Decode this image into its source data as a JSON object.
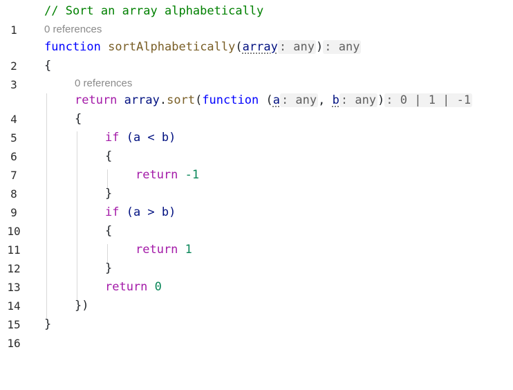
{
  "editor": {
    "line_numbers": [
      "1",
      "2",
      "3",
      "4",
      "5",
      "6",
      "7",
      "8",
      "9",
      "10",
      "11",
      "12",
      "13",
      "14",
      "15",
      "16"
    ],
    "codelens": {
      "fn_refs": "0 references",
      "inner_refs": "0 references"
    },
    "code": {
      "l1_comment": "// Sort an array alphabetically",
      "l2_kw": "function",
      "l2_name": "sortAlphabetically",
      "l2_open": "(",
      "l2_param": "array",
      "l2_param_hint": ": any",
      "l2_close": ")",
      "l2_return_hint": ": any",
      "l3": "{",
      "l4_kw": "return",
      "l4_obj": "array",
      "l4_dot": ".",
      "l4_method": "sort",
      "l4_open": "(",
      "l4_fnkw": "function",
      "l4_paren": " (",
      "l4_a": "a",
      "l4_a_hint": ": any",
      "l4_comma": ", ",
      "l4_b": "b",
      "l4_b_hint": ": any",
      "l4_close": ")",
      "l4_return_hint": ": 0 | 1 | -1",
      "l5": "{",
      "l6_if": "if",
      "l6_cond": " (a < b)",
      "l7": "{",
      "l8_return": "return",
      "l8_val": "-1",
      "l9": "}",
      "l10_if": "if",
      "l10_cond": " (a > b)",
      "l11": "{",
      "l12_return": "return",
      "l12_val": "1",
      "l13": "}",
      "l14_return": "return",
      "l14_val": "0",
      "l15": "})",
      "l16": "}"
    }
  }
}
